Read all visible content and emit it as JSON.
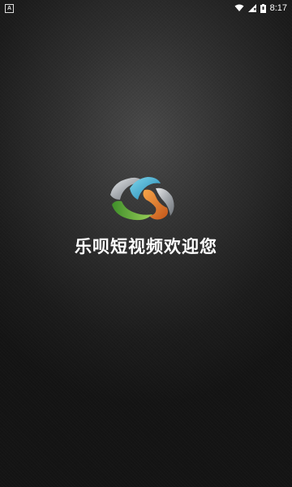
{
  "status_bar": {
    "notification_icon": "A",
    "time": "8:17"
  },
  "splash": {
    "welcome_text": "乐呗短视频欢迎您",
    "logo_colors": [
      "#b9bcc0",
      "#2fa8c8",
      "#5aa03a",
      "#e07a28"
    ]
  }
}
